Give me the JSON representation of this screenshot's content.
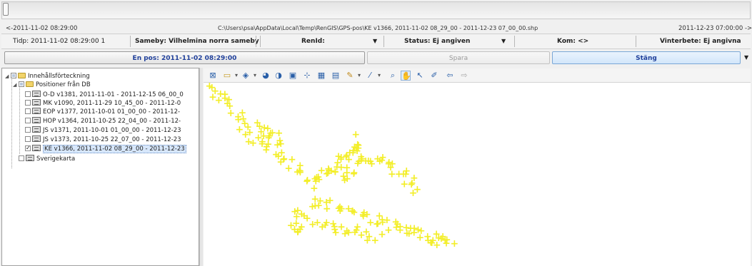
{
  "time_bar": {
    "start": "<-2011-11-02 08:29:00",
    "file_path": "C:\\Users\\psa\\AppData\\Local\\Temp\\RenGIS\\GPS-pos\\KE v1366, 2011-11-02 08_29_00 - 2011-12-23 07_00_00.shp",
    "end": "2011-12-23 07:00:00 ->"
  },
  "info": {
    "tidp": "Tidp: 2011-11-02 08:29:00 1",
    "sameby": "Sameby: Vilhelmina norra sameby",
    "renid": "RenId:",
    "status": "Status: Ej angiven",
    "kom": "Kom: <>",
    "vinterbete": "Vinterbete: Ej angivna"
  },
  "buttons": {
    "en_pos": "En pos: 2011-11-02 08:29:00",
    "spara": "Spara",
    "stang": "Stäng"
  },
  "tree": {
    "root": "Innehållsförteckning",
    "group": "Positioner från DB",
    "layers": [
      {
        "label": "O-D v1381, 2011-11-01 - 2011-12-15 06_00_0",
        "checked": false
      },
      {
        "label": "MK v1090, 2011-11-29 10_45_00 - 2011-12-0",
        "checked": false
      },
      {
        "label": "EOP v1377, 2011-10-01 01_00_00 - 2011-12-",
        "checked": false
      },
      {
        "label": "HOP v1364, 2011-10-25 22_04_00 - 2011-12-",
        "checked": false
      },
      {
        "label": "JS v1371, 2011-10-01 01_00_00 - 2011-12-23",
        "checked": false
      },
      {
        "label": "JS v1373, 2011-10-25 22_07_00 - 2011-12-23",
        "checked": false
      },
      {
        "label": "KE v1366, 2011-11-02 08_29_00 - 2011-12-23",
        "checked": true
      }
    ],
    "basemap": "Sverigekarta"
  },
  "toolbar_icons": [
    "zoom-full-icon",
    "open-folder-icon",
    "dropdown-icon",
    "layer-add-icon",
    "dropdown-icon",
    "theme-icon",
    "pie-icon",
    "table-icon",
    "measure-icon",
    "grid-icon",
    "save-map-icon",
    "paint-icon",
    "dropdown-icon",
    "draw-line-icon",
    "dropdown-icon",
    "zoom-in-icon",
    "pan-icon",
    "select-icon",
    "edit-icon",
    "back-icon",
    "forward-icon"
  ],
  "colors": {
    "point_fill": "#f3ee2a",
    "active_button_text": "#1f3f9a",
    "selection": "#d7e7fb"
  }
}
